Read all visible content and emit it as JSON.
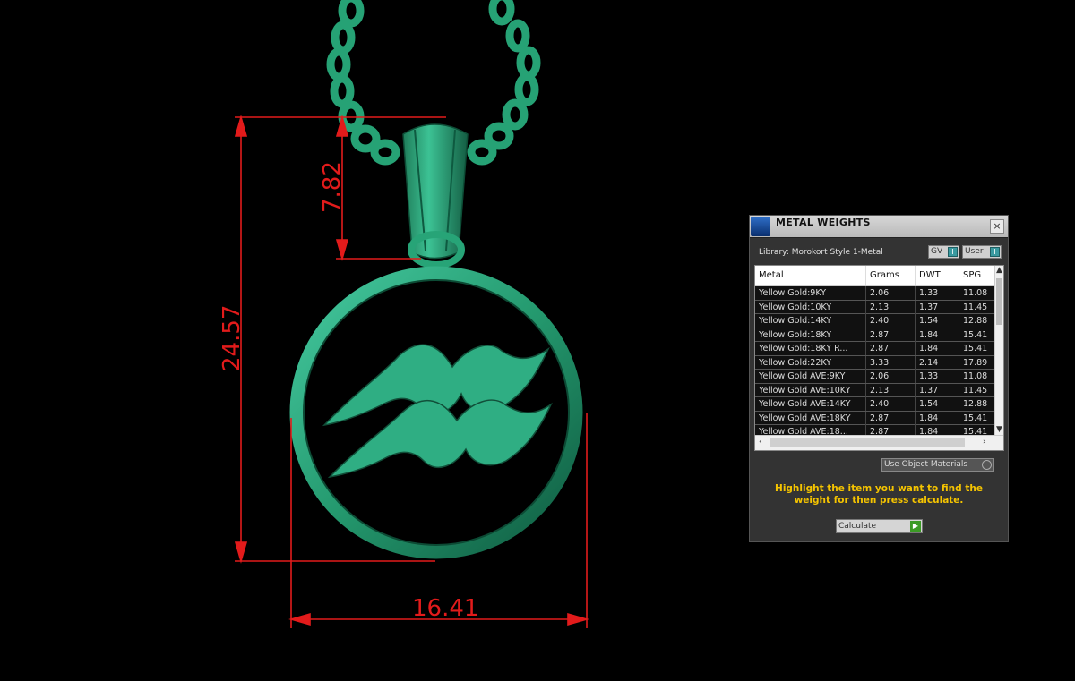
{
  "dimensions": {
    "bail_height": "7.82",
    "total_height": "24.57",
    "width": "16.41"
  },
  "panel": {
    "title": "METAL WEIGHTS",
    "library": "Library: Morokort Style 1-Metal",
    "toggle_gv": "GV",
    "toggle_user": "User",
    "columns": [
      "Metal",
      "Grams",
      "DWT",
      "SPG"
    ],
    "rows": [
      [
        "Yellow Gold:9KY",
        "2.06",
        "1.33",
        "11.08"
      ],
      [
        "Yellow Gold:10KY",
        "2.13",
        "1.37",
        "11.45"
      ],
      [
        "Yellow Gold:14KY",
        "2.40",
        "1.54",
        "12.88"
      ],
      [
        "Yellow Gold:18KY",
        "2.87",
        "1.84",
        "15.41"
      ],
      [
        "Yellow Gold:18KY R...",
        "2.87",
        "1.84",
        "15.41"
      ],
      [
        "Yellow Gold:22KY",
        "3.33",
        "2.14",
        "17.89"
      ],
      [
        "Yellow Gold AVE:9KY",
        "2.06",
        "1.33",
        "11.08"
      ],
      [
        "Yellow Gold AVE:10KY",
        "2.13",
        "1.37",
        "11.45"
      ],
      [
        "Yellow Gold AVE:14KY",
        "2.40",
        "1.54",
        "12.88"
      ],
      [
        "Yellow Gold AVE:18KY",
        "2.87",
        "1.84",
        "15.41"
      ],
      [
        "Yellow Gold AVE:18...",
        "2.87",
        "1.84",
        "15.41"
      ]
    ],
    "use_object_materials": "Use Object Materials",
    "hint": "Highlight the item you want to find the weight for then press calculate.",
    "calculate": "Calculate"
  },
  "colors": {
    "model": "#2aa77a",
    "dimension": "#e21b1b",
    "hint": "#f5c400"
  }
}
